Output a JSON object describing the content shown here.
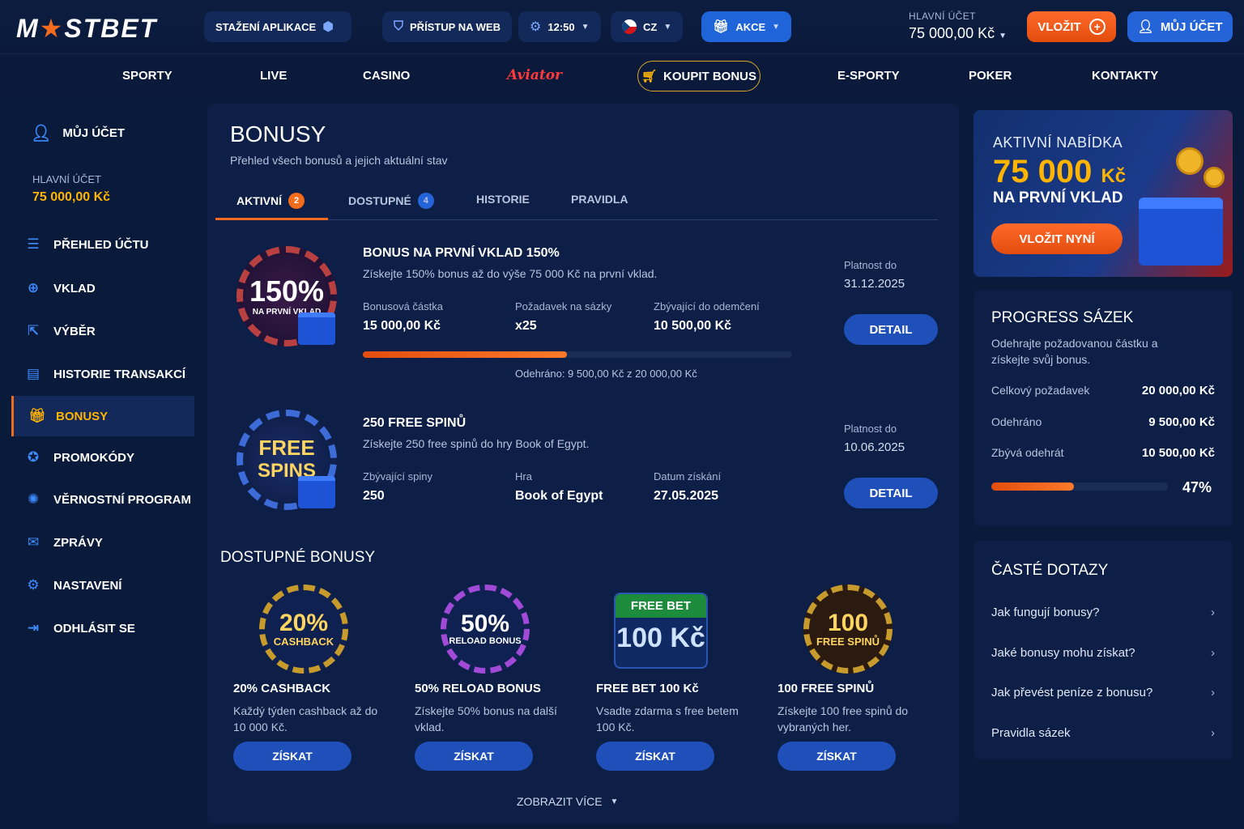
{
  "header": {
    "logo": "MOSTBET",
    "app_download": "STAŽENÍ APLIKACE",
    "web_access": "PŘÍSTUP NA WEB",
    "time": "12:50",
    "language": "CZ",
    "promo": "AKCE",
    "main_account_label": "HLAVNÍ ÚČET",
    "main_account_value": "75 000,00 Kč",
    "deposit_label": "VLOŽIT",
    "my_account_label": "MŮJ ÚČET"
  },
  "nav": {
    "items": [
      "SPORTY",
      "LIVE",
      "CASINO",
      "Aviator",
      "KOUPIT BONUS",
      "E-SPORTY",
      "POKER",
      "KONTAKTY"
    ]
  },
  "sidebar": {
    "account": "MŮJ ÚČET",
    "main_label": "HLAVNÍ ÚČET",
    "main_value": "75 000,00 Kč",
    "items": [
      {
        "label": "PŘEHLED ÚČTU",
        "icon": "list-icon"
      },
      {
        "label": "VKLAD",
        "icon": "plus-circle-icon"
      },
      {
        "label": "VÝBĚR",
        "icon": "withdraw-icon"
      },
      {
        "label": "HISTORIE TRANSAKCÍ",
        "icon": "history-icon"
      },
      {
        "label": "BONUSY",
        "icon": "gift-icon"
      },
      {
        "label": "PROMOKÓDY",
        "icon": "tag-icon"
      },
      {
        "label": "VĚRNOSTNÍ PROGRAM",
        "icon": "badge-icon"
      },
      {
        "label": "ZPRÁVY",
        "icon": "mail-icon"
      },
      {
        "label": "NASTAVENÍ",
        "icon": "gear-icon"
      },
      {
        "label": "ODHLÁSIT SE",
        "icon": "logout-icon"
      }
    ]
  },
  "main": {
    "title": "BONUSY",
    "subtitle": "Přehled všech bonusů a jejich aktuální stav",
    "tabs": [
      {
        "label": "AKTIVNÍ",
        "count": "2"
      },
      {
        "label": "DOSTUPNÉ",
        "count": "4"
      },
      {
        "label": "HISTORIE"
      },
      {
        "label": "PRAVIDLA"
      }
    ],
    "active_bonuses": [
      {
        "chip_big": "150%",
        "chip_small": "NA PRVNÍ VKLAD",
        "title": "BONUS NA PRVNÍ VKLAD 150%",
        "desc": "Získejte 150% bonus až do výše 75 000 Kč na první vklad.",
        "f1_label": "Bonusová částka",
        "f1_value": "15 000,00 Kč",
        "f2_label": "Požadavek na sázky",
        "f2_value": "x25",
        "f3_label": "Zbývající do odemčení",
        "f3_value": "10 500,00 Kč",
        "valid_label": "Platnost do",
        "valid_value": "31.12.2025",
        "detail": "DETAIL",
        "progress": 0.475,
        "progress_text": "Odehráno: 9 500,00 Kč z 20 000,00 Kč"
      },
      {
        "chip_big": "FREE",
        "chip_small": "SPINS",
        "title": "250 FREE SPINŮ",
        "desc": "Získejte 250 free spinů do hry Book of Egypt.",
        "f1_label": "Zbývající spiny",
        "f1_value": "250",
        "f2_label": "Hra",
        "f2_value": "Book of Egypt",
        "f3_label": "Datum získání",
        "f3_value": "27.05.2025",
        "valid_label": "Platnost do",
        "valid_value": "10.06.2025",
        "detail": "DETAIL"
      }
    ],
    "available_title": "DOSTUPNÉ BONUSY",
    "available": [
      {
        "chip_big": "20%",
        "chip_small": "CASHBACK",
        "title": "20% CASHBACK",
        "desc": "Každý týden cashback až do 10 000 Kč.",
        "btn": "ZÍSKAT"
      },
      {
        "chip_big": "50%",
        "chip_small": "RELOAD BONUS",
        "title": "50% RELOAD BONUS",
        "desc": "Získejte 50% bonus na další vklad.",
        "btn": "ZÍSKAT"
      },
      {
        "chip_big": "100 Kč",
        "chip_small": "FREE BET",
        "title": "FREE BET 100 Kč",
        "desc": "Vsadte zdarma s free betem 100 Kč.",
        "btn": "ZÍSKAT"
      },
      {
        "chip_big": "100",
        "chip_small": "FREE SPINŮ",
        "title": "100 FREE SPINŮ",
        "desc": "Získejte 100 free spinů do vybraných her.",
        "btn": "ZÍSKAT"
      }
    ],
    "show_more": "ZOBRAZIT VÍCE"
  },
  "promo": {
    "l1": "AKTIVNÍ NABÍDKA",
    "amount": "75 000",
    "currency": "Kč",
    "l3": "NA PRVNÍ VKLAD",
    "btn": "VLOŽIT NYNÍ"
  },
  "progress": {
    "title": "PROGRESS SÁZEK",
    "desc": "Odehrajte požadovanou částku a získejte svůj bonus.",
    "rows": [
      {
        "k": "Celkový požadavek",
        "v": "20 000,00 Kč"
      },
      {
        "k": "Odehráno",
        "v": "9 500,00 Kč"
      },
      {
        "k": "Zbývá odehrát",
        "v": "10 500,00 Kč"
      }
    ],
    "percent_label": "47%",
    "percent": 0.47
  },
  "faq": {
    "title": "ČASTÉ DOTAZY",
    "items": [
      "Jak fungují bonusy?",
      "Jaké bonusy mohu získat?",
      "Jak převést peníze z bonusu?",
      "Pravidla sázek"
    ]
  }
}
